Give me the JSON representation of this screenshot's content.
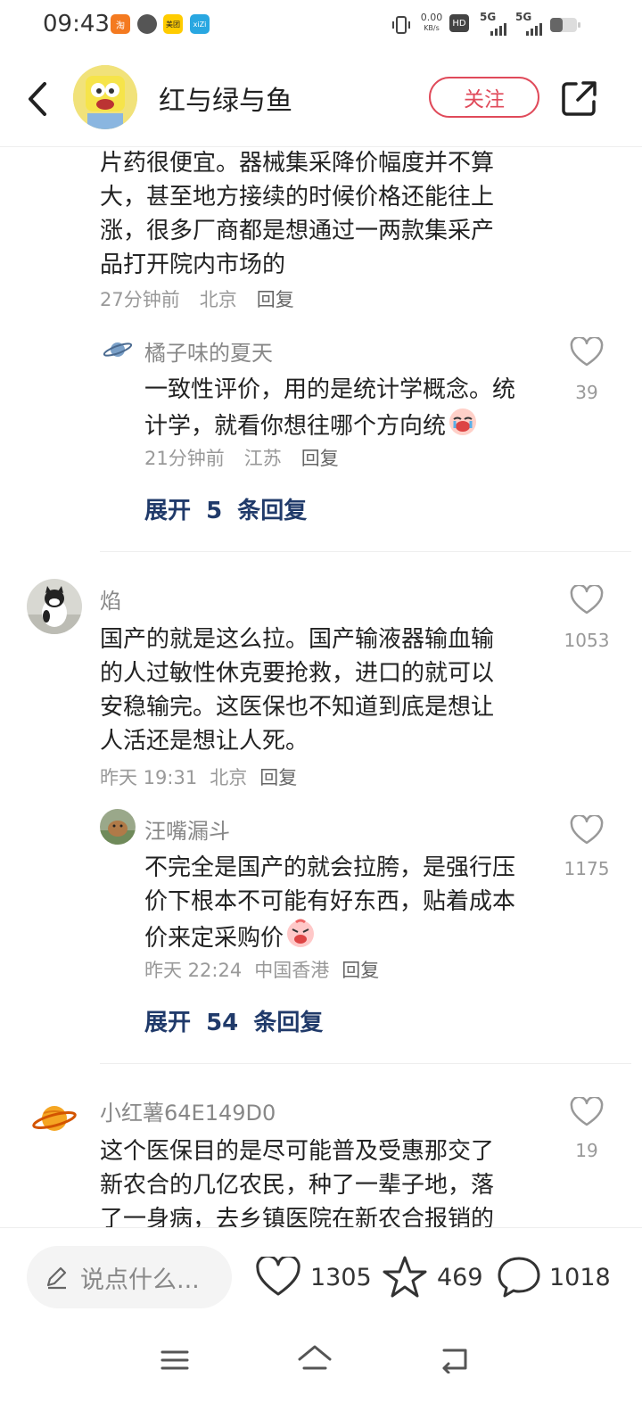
{
  "status_bar": {
    "time": "09:43",
    "net_speed": "0.00",
    "net_unit": "KB/s",
    "hd": "HD",
    "sig1": "5G",
    "sig2": "5G",
    "app_icons": [
      "淘",
      "美团",
      "xiZi"
    ]
  },
  "header": {
    "author": "红与绿与鱼",
    "follow_label": "关注"
  },
  "comments": {
    "c0": {
      "lines": [
        "片药很便宜。器械集采降价幅度并不算",
        "大，甚至地方接续的时候价格还能往上",
        "涨，很多厂商都是想通过一两款集采产",
        "品打开院内市场的"
      ],
      "time": "27分钟前",
      "location": "北京",
      "reply": "回复"
    },
    "r0": {
      "user": "橘子味的夏天",
      "lines": [
        "一致性评价，用的是统计学概念。统",
        "计学，就看你想往哪个方向统"
      ],
      "time": "21分钟前",
      "location": "江苏",
      "reply": "回复",
      "likes": "39"
    },
    "expand0": {
      "pre": "展开",
      "num": "5",
      "post": "条回复"
    },
    "c1": {
      "user": "焰",
      "lines": [
        "国产的就是这么拉。国产输液器输血输",
        "的人过敏性休克要抢救，进口的就可以",
        "安稳输完。这医保也不知道到底是想让",
        "人活还是想让人死。"
      ],
      "time": "昨天 19:31",
      "location": "北京",
      "reply": "回复",
      "likes": "1053"
    },
    "r1": {
      "user": "汪嘴漏斗",
      "lines": [
        "不完全是国产的就会拉胯，是强行压",
        "价下根本不可能有好东西，贴着成本",
        "价来定采购价"
      ],
      "time": "昨天 22:24",
      "location": "中国香港",
      "reply": "回复",
      "likes": "1175"
    },
    "expand1": {
      "pre": "展开",
      "num": "54",
      "post": "条回复"
    },
    "c2": {
      "user": "小红薯64E149D0",
      "lines": [
        "这个医保目的是尽可能普及受惠那交了",
        "新农合的几亿农民，种了一辈子地，落",
        "了一身病，去乡镇医院在新农合报销的"
      ],
      "likes": "19"
    }
  },
  "bottom_bar": {
    "input_placeholder": "说点什么...",
    "likes": "1305",
    "stars": "469",
    "comments": "1018"
  },
  "colors": {
    "accent": "#e04a5a",
    "expand": "#203a6a"
  },
  "icons": [
    "back-icon",
    "share-icon",
    "heart-icon",
    "star-icon",
    "comment-icon",
    "pencil-icon",
    "menu-icon",
    "home-icon",
    "return-icon"
  ]
}
